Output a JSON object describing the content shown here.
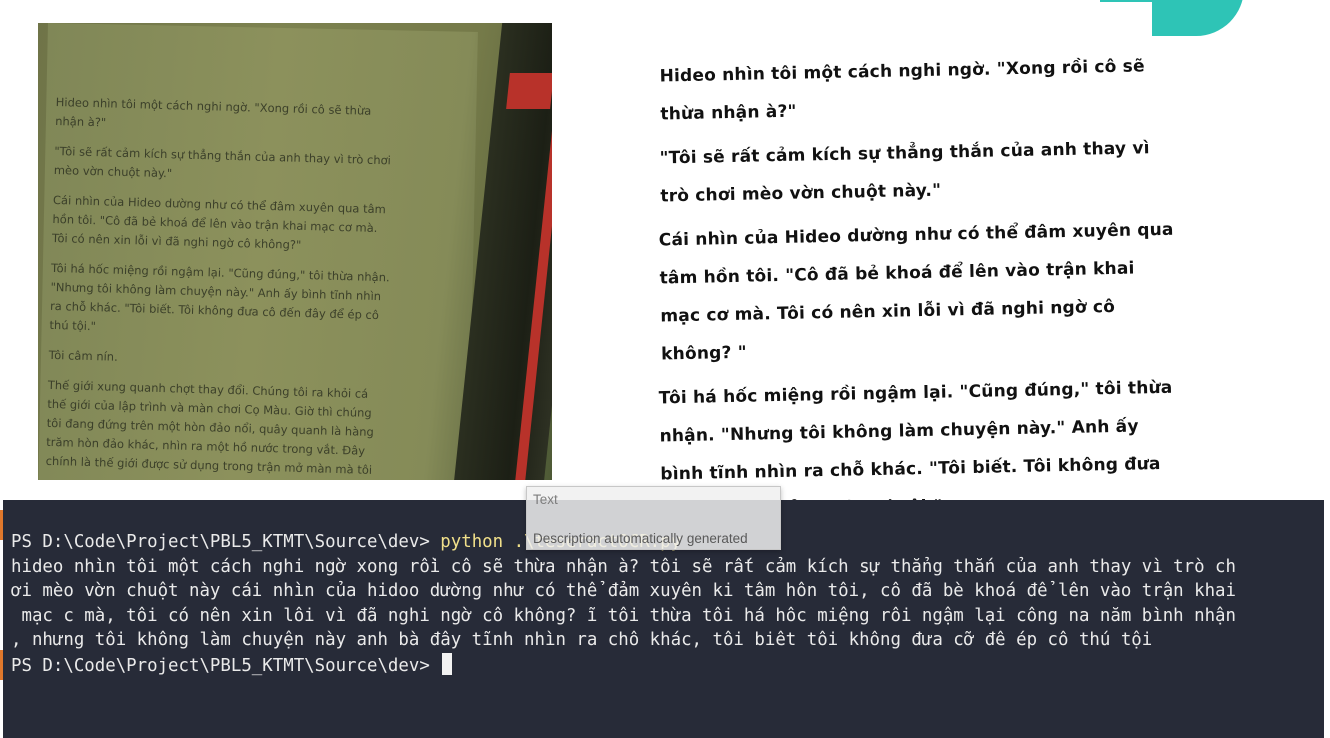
{
  "photo": {
    "paragraphs": [
      "Hideo nhìn tôi một cách nghi ngờ. \"Xong rồi cô sẽ thừa nhận à?\"",
      "\"Tôi sẽ rất cảm kích sự thẳng thắn của anh thay vì trò chơi mèo vờn chuột này.\"",
      "Cái nhìn của Hideo dường như có thể đâm xuyên qua tâm hồn tôi. \"Cô đã bẻ khoá để lên vào trận khai mạc cơ mà. Tôi có nên xin lỗi vì đã nghi ngờ cô không?\"",
      "Tôi há hốc miệng rồi ngậm lại. \"Cũng đúng,\" tôi thừa nhận. \"Nhưng tôi không làm chuyện này.\" Anh ấy bình tĩnh nhìn ra chỗ khác. \"Tôi biết. Tôi không đưa cô đến đây để ép cô thú tội.\"",
      "Tôi câm nín.",
      "Thế giới xung quanh chợt thay đổi. Chúng tôi ra khỏi cá thế giới của lập trình và màn chơi Cọ Màu. Giờ thì chúng tôi đang đứng trên một hòn đảo nổi, quây quanh là hàng trăm hòn đảo khác, nhìn ra một hồ nước trong vắt. Đây chính là thế giới được sử dụng trong trận mở màn mà tôi"
    ]
  },
  "scan": {
    "paragraphs": [
      "Hideo nhìn tôi một cách nghi ngờ. \"Xong rồi cô sẽ thừa nhận à?\"",
      "\"Tôi sẽ rất cảm kích sự thẳng thắn của anh thay vì trò chơi mèo vờn chuột này.\"",
      "Cái nhìn của Hideo dường như có thể đâm xuyên qua tâm hồn tôi. \"Cô đã bẻ khoá để lên vào trận khai mạc cơ mà. Tôi có nên xin lỗi vì đã nghi ngờ cô không? \"",
      "Tôi há hốc miệng rồi ngậm lại. \"Cũng đúng,\" tôi thừa nhận. \"Nhưng tôi không làm chuyện này.\" Anh ấy bình tĩnh nhìn ra chỗ khác. \"Tôi biết. Tôi không đưa cô đến đây để ép cô thú tội.\""
    ]
  },
  "terminal": {
    "prompt": "PS D:\\Code\\Project\\PBL5_KTMT\\Source\\dev> ",
    "command": "python .\\teseractOCR.py",
    "output": [
      "hideo nhìn tôi một cách nghi ngờ xong rồi cô sẽ thừa nhận à? tôi sẽ rất cảm kích sự thẳng thắn của anh thay vì trò ch",
      "ơi mèo vờn chuột này cái nhìn của hidoo dường như có thể đảm xuyên ki tâm hôn tôi, cô đã bè khoá để lên vào trận khai",
      " mạc c mà, tôi có nên xin lôi vì đã nghi ngờ cô không? ĩ tôi thừa tôi há hôc miệng rôi ngậm lại công na năm bình nhận",
      ", nhưng tôi không làm chuyện này anh bà đây tĩnh nhìn ra chô khác, tôi biêt tôi không đưa cỡ đê ép cô thú tội"
    ],
    "prompt2": "PS D:\\Code\\Project\\PBL5_KTMT\\Source\\dev> "
  },
  "tooltip": {
    "title": "Text",
    "description": "Description automatically generated"
  },
  "colors": {
    "terminal_bg": "#272b38",
    "command": "#f1e08a",
    "accent": "#2ec4b6"
  }
}
